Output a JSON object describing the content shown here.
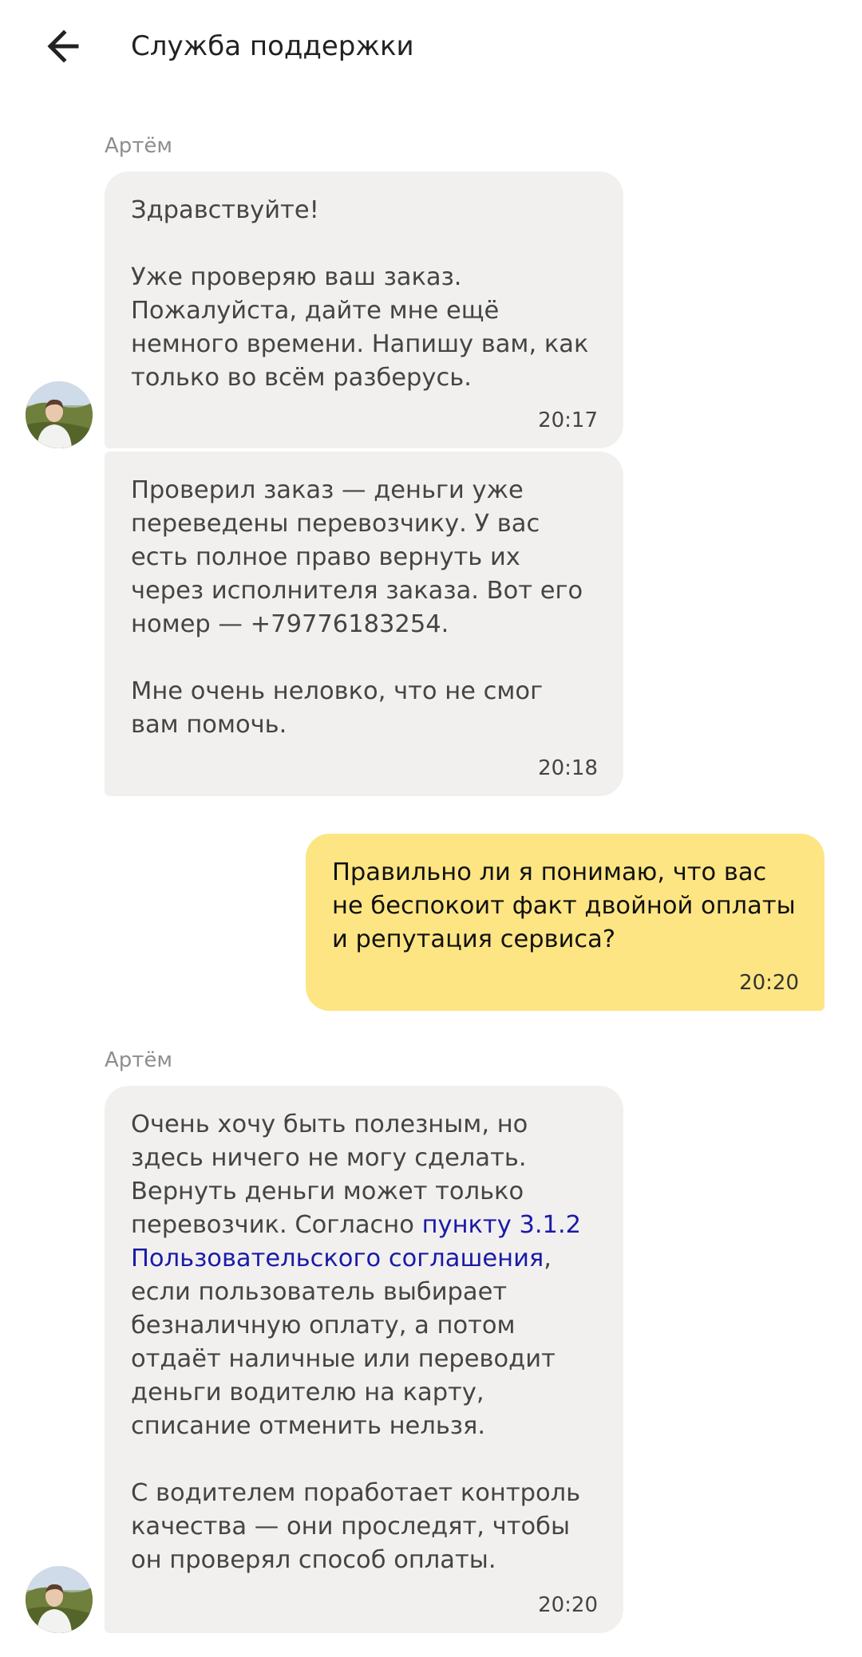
{
  "header": {
    "title": "Служба поддержки"
  },
  "messages": [
    {
      "sender": "Артём",
      "text": "Здравствуйте!\n\nУже проверяю ваш заказ. Пожалуйста, дайте мне ещё немного времени. Напишу вам, как только во всём разберусь.",
      "time": "20:17"
    },
    {
      "text": "Проверил заказ — деньги уже переведены перевозчику. У вас есть полное право вернуть их через исполнителя заказа. Вот его номер — +79776183254.\n\nМне очень неловко, что не смог вам помочь.",
      "time": "20:18"
    },
    {
      "text": "Правильно ли я понимаю, что вас не беспокоит факт двойной оплаты и репутация сервиса?",
      "time": "20:20"
    },
    {
      "sender": "Артём",
      "text_before": "Очень хочу быть полезным, но здесь ничего не могу сделать. Вернуть деньги может только перевозчик. Согласно ",
      "link": "пункту 3.1.2 Пользовательского соглашения",
      "text_after": ", если пользователь выбирает безналичную оплату, а потом отдаёт наличные или переводит деньги водителю на карту, списание отменить нельзя.\n\nС водителем поработает контроль качества — они проследят, чтобы он проверял способ оплаты.",
      "time": "20:20"
    }
  ],
  "icons": {
    "back": "arrow-left-icon",
    "avatar": "agent-avatar"
  },
  "colors": {
    "incoming_bubble": "#f1f0ef",
    "outgoing_bubble": "#fde583",
    "link": "#1a1aa8",
    "sender_name": "#8e8e8e"
  }
}
